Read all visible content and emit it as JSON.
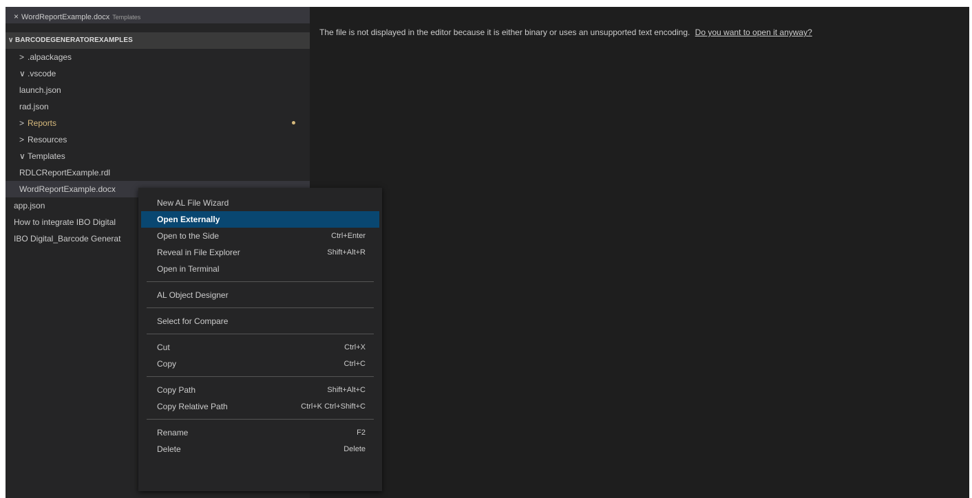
{
  "open_editor": {
    "close_glyph": "×",
    "file": "WordReportExample.docx",
    "folder": "Templates"
  },
  "explorer": {
    "root": "BARCODEGENERATOREXAMPLES",
    "items": [
      {
        "label": ".alpackages",
        "chevron": ">",
        "indent": 20
      },
      {
        "label": ".vscode",
        "chevron": "∨",
        "indent": 20
      },
      {
        "label": "launch.json",
        "chevron": "",
        "indent": 20
      },
      {
        "label": "rad.json",
        "chevron": "",
        "indent": 20
      },
      {
        "label": "Reports",
        "chevron": ">",
        "indent": 20
      },
      {
        "label": "Resources",
        "chevron": ">",
        "indent": 20
      },
      {
        "label": "Templates",
        "chevron": "∨",
        "indent": 20
      },
      {
        "label": "RDLCReportExample.rdl",
        "chevron": "",
        "indent": 20
      },
      {
        "label": "WordReportExample.docx",
        "chevron": "",
        "indent": 20
      },
      {
        "label": "app.json",
        "chevron": "",
        "indent": 12
      },
      {
        "label": "How to integrate IBO Digital",
        "chevron": "",
        "indent": 12
      },
      {
        "label": "IBO Digital_Barcode Generat",
        "chevron": "",
        "indent": 12
      }
    ]
  },
  "editor": {
    "message": "The file is not displayed in the editor because it is either binary or uses an unsupported text encoding.",
    "link": "Do you want to open it anyway?"
  },
  "context_menu": {
    "groups": [
      [
        {
          "label": "New AL File Wizard",
          "shortcut": ""
        },
        {
          "label": "Open Externally",
          "shortcut": ""
        },
        {
          "label": "Open to the Side",
          "shortcut": "Ctrl+Enter"
        },
        {
          "label": "Reveal in File Explorer",
          "shortcut": "Shift+Alt+R"
        },
        {
          "label": "Open in Terminal",
          "shortcut": ""
        }
      ],
      [
        {
          "label": "AL Object Designer",
          "shortcut": ""
        }
      ],
      [
        {
          "label": "Select for Compare",
          "shortcut": ""
        }
      ],
      [
        {
          "label": "Cut",
          "shortcut": "Ctrl+X"
        },
        {
          "label": "Copy",
          "shortcut": "Ctrl+C"
        }
      ],
      [
        {
          "label": "Copy Path",
          "shortcut": "Shift+Alt+C"
        },
        {
          "label": "Copy Relative Path",
          "shortcut": "Ctrl+K Ctrl+Shift+C"
        }
      ],
      [
        {
          "label": "Rename",
          "shortcut": "F2"
        },
        {
          "label": "Delete",
          "shortcut": "Delete"
        }
      ]
    ]
  },
  "colors": {
    "modified": "#d7ba7d",
    "menu_highlight": "#094771"
  }
}
